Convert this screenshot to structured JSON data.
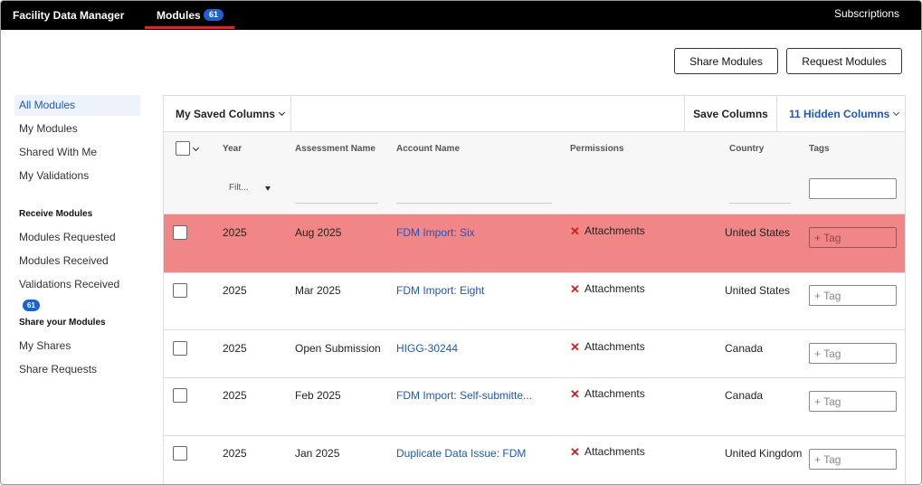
{
  "topbar": {
    "brand": "Facility Data Manager",
    "active_tab": {
      "label": "Modules",
      "badge": "61"
    },
    "subscriptions": "Subscriptions"
  },
  "actions": {
    "share": "Share Modules",
    "request": "Request Modules"
  },
  "sidebar": {
    "items": [
      {
        "label": "All Modules"
      },
      {
        "label": "My Modules"
      },
      {
        "label": "Shared With Me"
      },
      {
        "label": "My Validations"
      }
    ],
    "receive": {
      "heading": "Receive Modules",
      "items": [
        {
          "label": "Modules Requested"
        },
        {
          "label": "Modules Received"
        },
        {
          "label": "Validations Received",
          "badge": "61"
        }
      ]
    },
    "share": {
      "heading": "Share your Modules",
      "items": [
        {
          "label": "My Shares"
        },
        {
          "label": "Share Requests"
        }
      ]
    }
  },
  "toolbar": {
    "saved_columns": "My Saved Columns",
    "save_columns": "Save Columns",
    "hidden_columns": "11 Hidden Columns"
  },
  "table": {
    "headers": {
      "year": "Year",
      "assessment": "Assessment Name",
      "account": "Account Name",
      "permissions": "Permissions",
      "country": "Country",
      "tags": "Tags"
    },
    "year_filter_placeholder": "Filt...",
    "tag_placeholder": "+ Tag",
    "rows": [
      {
        "year": "2025",
        "assessment": "Aug 2025",
        "account": "FDM Import: Six",
        "permission": "Attachments",
        "country": "United States"
      },
      {
        "year": "2025",
        "assessment": "Mar 2025",
        "account": "FDM Import: Eight",
        "permission": "Attachments",
        "country": "United States"
      },
      {
        "year": "2025",
        "assessment": "Open Submission",
        "account": "HIGG-30244",
        "permission": "Attachments",
        "country": "Canada"
      },
      {
        "year": "2025",
        "assessment": "Feb 2025",
        "account": "FDM Import: Self-submitte...",
        "permission": "Attachments",
        "country": "Canada"
      },
      {
        "year": "2025",
        "assessment": "Jan 2025",
        "account": "Duplicate Data Issue: FDM",
        "permission": "Attachments",
        "country": "United Kingdom"
      }
    ]
  },
  "colors": {
    "accent": "#1b56c7",
    "badge": "#1b63d3",
    "tab_underline": "#e0242b",
    "row_highlight": "#f08686",
    "deny": "#d21d1d"
  }
}
